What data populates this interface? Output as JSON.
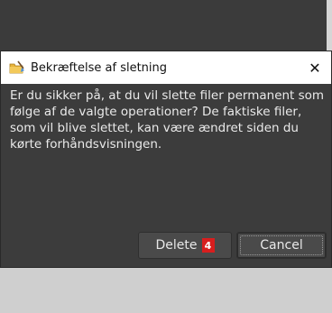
{
  "dialog": {
    "title": "Bekræftelse af sletning",
    "icon": "folder-broom-icon",
    "close_glyph": "✕",
    "message": "Er du sikker på, at du vil slette filer permanent som følge af de valgte operationer? De faktiske filer, som vil blive slettet, kan være ændret siden du kørte forhåndsvisningen.",
    "buttons": {
      "delete_label": "Delete",
      "delete_count": "4",
      "cancel_label": "Cancel"
    }
  },
  "colors": {
    "dialog_bg": "#3c3c3c",
    "titlebar_bg": "#ffffff",
    "badge": "#d81e1e"
  }
}
